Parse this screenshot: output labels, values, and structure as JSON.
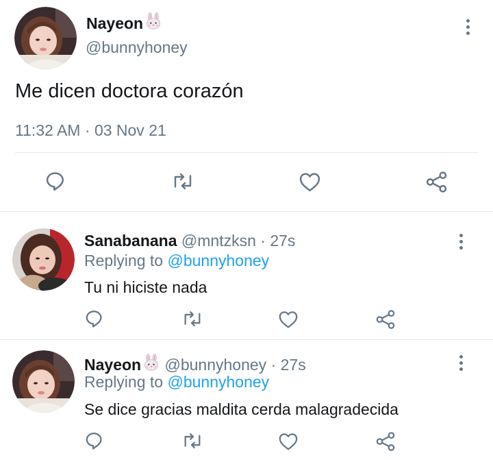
{
  "main_tweet": {
    "author_name": "Nayeon",
    "author_emoji": "rabbit-face-emoji",
    "handle": "@bunnyhoney",
    "text": "Me dicen doctora corazón",
    "time": "11:32 AM",
    "separator": "·",
    "date": "03 Nov 21",
    "more_icon": "more-vertical-icon",
    "actions": [
      "reply-icon",
      "retweet-icon",
      "like-icon",
      "share-icon"
    ]
  },
  "replies": [
    {
      "author_name": "Sanabanana",
      "handle": "@mntzksn",
      "separator": "·",
      "time": "27s",
      "replying_prefix": "Replying to",
      "replying_handle": "@bunnyhoney",
      "text": "Tu ni hiciste nada"
    },
    {
      "author_name": "Nayeon",
      "author_emoji": "rabbit-face-emoji",
      "handle": "@bunnyhoney",
      "separator": "·",
      "time": "27s",
      "replying_prefix": "Replying to",
      "replying_handle": "@bunnyhoney",
      "text": "Se dice gracias maldita cerda malagradecida"
    }
  ],
  "colors": {
    "text_primary": "#14171a",
    "text_secondary": "#657786",
    "accent": "#1da1f2",
    "divider": "#e1e8ed"
  }
}
